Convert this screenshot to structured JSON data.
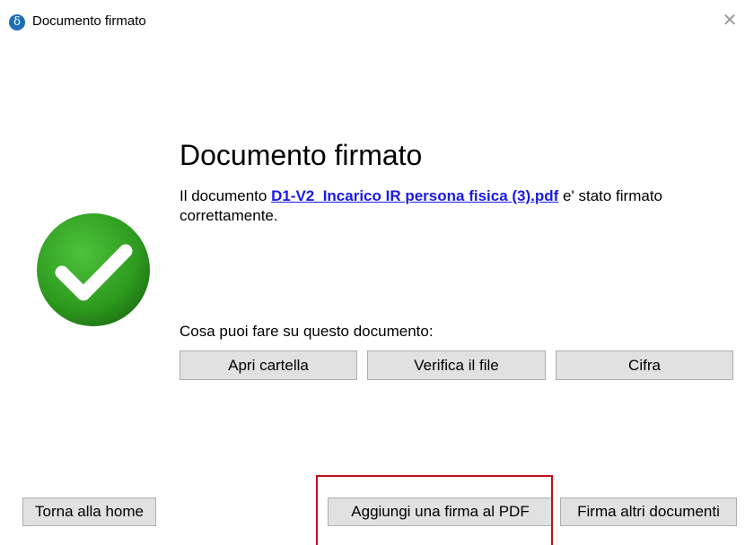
{
  "window": {
    "title": "Documento firmato",
    "app_icon_glyph": "δ",
    "close_glyph": "✕"
  },
  "main": {
    "heading": "Documento firmato",
    "message_prefix": "Il documento ",
    "document_name": "D1-V2_Incarico IR persona fisica (3).pdf",
    "message_suffix": " e' stato firmato correttamente.",
    "actions_label": "Cosa puoi fare su questo documento:",
    "status_icon": "checkmark-success-icon"
  },
  "actions": {
    "open_folder": "Apri cartella",
    "verify_file": "Verifica il file",
    "encrypt": "Cifra"
  },
  "footer": {
    "home": "Torna alla home",
    "add_signature": "Aggiungi una firma al PDF",
    "sign_more": "Firma altri documenti"
  },
  "colors": {
    "success_green": "#2e9b1f",
    "link_blue": "#1a1ae6",
    "highlight_red": "#c0101a",
    "button_bg": "#e1e1e1"
  }
}
